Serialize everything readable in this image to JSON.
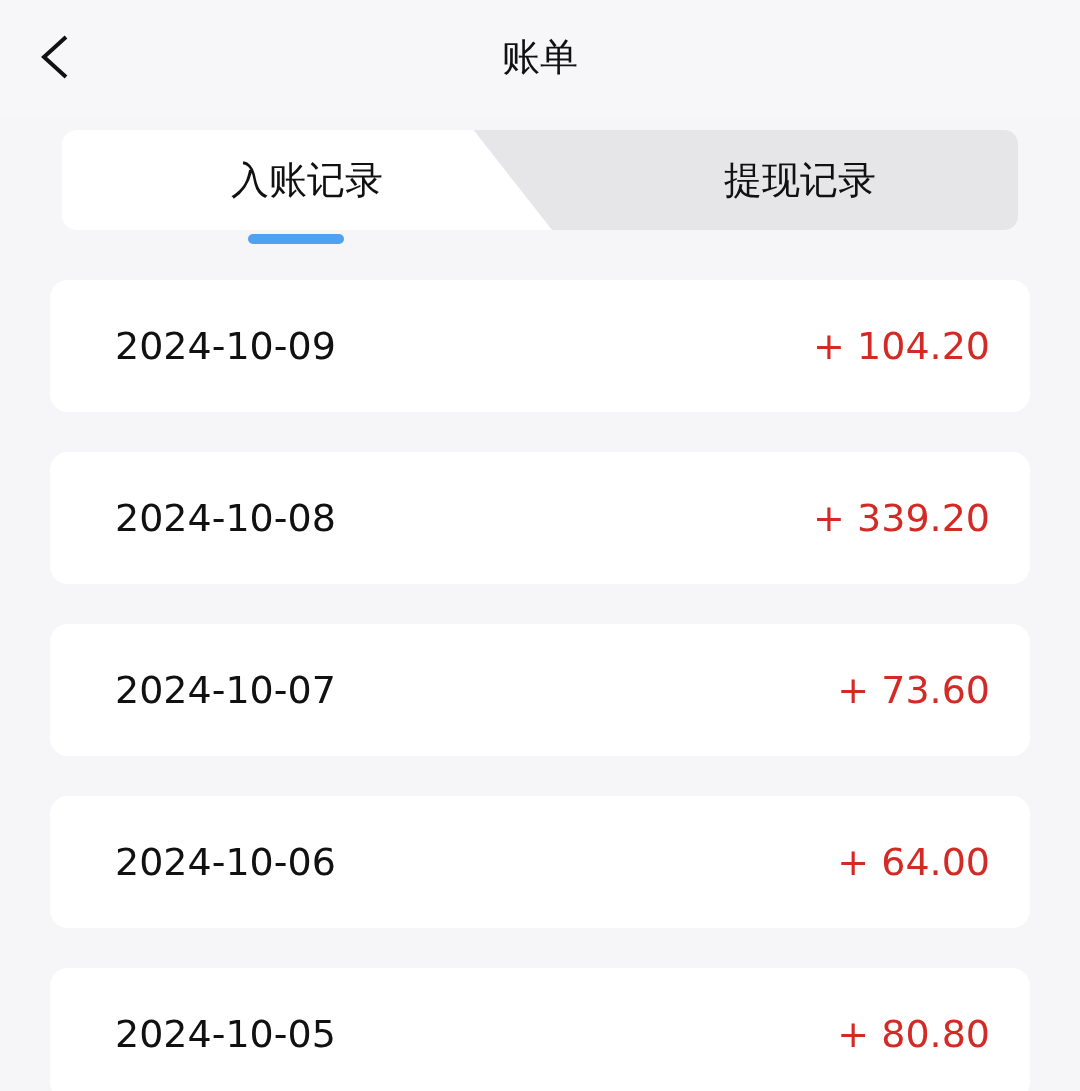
{
  "header": {
    "title": "账单"
  },
  "tabs": [
    {
      "label": "入账记录",
      "selected": true
    },
    {
      "label": "提现记录",
      "selected": false
    }
  ],
  "records": [
    {
      "date": "2024-10-09",
      "amount": "+ 104.20"
    },
    {
      "date": "2024-10-08",
      "amount": "+ 339.20"
    },
    {
      "date": "2024-10-07",
      "amount": "+ 73.60"
    },
    {
      "date": "2024-10-06",
      "amount": "+ 64.00"
    },
    {
      "date": "2024-10-05",
      "amount": "+ 80.80"
    }
  ]
}
